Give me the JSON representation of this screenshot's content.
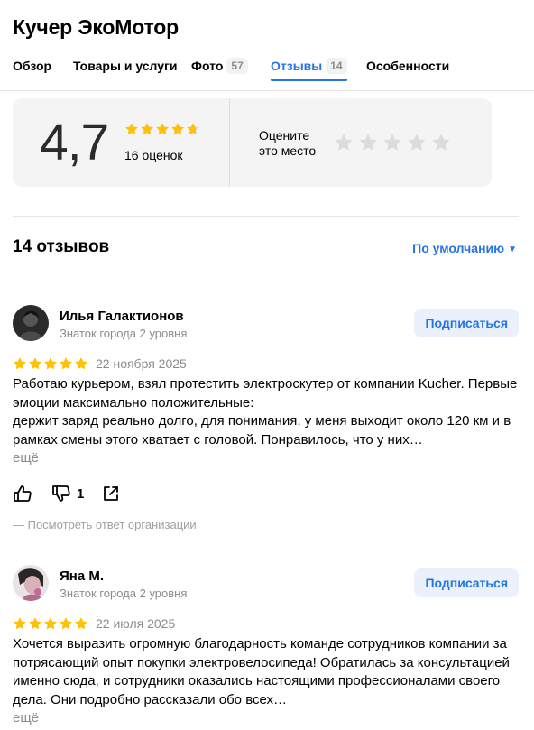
{
  "header": {
    "title": "Кучер ЭкоМотор"
  },
  "tabs": [
    {
      "label": "Обзор",
      "count": null
    },
    {
      "label": "Товары и услуги",
      "count": null
    },
    {
      "label": "Фото",
      "count": "57"
    },
    {
      "label": "Отзывы",
      "count": "14"
    },
    {
      "label": "Особенности",
      "count": null
    }
  ],
  "active_tab": "Отзывы",
  "rating": {
    "value": "4,7",
    "stars": 4.7,
    "count_label": "16 оценок",
    "rate_prompt_line1": "Оцените",
    "rate_prompt_line2": "это место",
    "rate_star_count": 5
  },
  "reviews_section": {
    "title": "14 отзывов",
    "sort_label": "По умолчанию"
  },
  "colors": {
    "accent": "#2673e3",
    "star": "#ffc107",
    "star_empty": "#dcdcdc",
    "muted": "#8c8c8c"
  },
  "reviews": [
    {
      "author": "Илья Галактионов",
      "level": "Знаток города 2 уровня",
      "subscribe_label": "Подписаться",
      "stars": 5,
      "date": "22 ноября 2025",
      "text": "Работаю курьером, взял протестить электроскутер от компании Kucher. Первые эмоции максимально положительные:\nдержит заряд реально долго, для понимания, у меня выходит около 120 км и в рамках смены этого хватает с головой. Понравилось, что у них…",
      "more_label": "ещё",
      "dislikes": "1",
      "org_answer_label": "— Посмотреть ответ организации"
    },
    {
      "author": "Яна М.",
      "level": "Знаток города 2 уровня",
      "subscribe_label": "Подписаться",
      "stars": 5,
      "date": "22 июля 2025",
      "text": "Хочется выразить огромную благодарность команде сотрудников компании за потрясающий опыт покупки электровелосипеда! Обратилась за консультацией именно сюда, и сотрудники оказались настоящими профессионалами своего дела. Они подробно рассказали обо всех…",
      "more_label": "ещё"
    }
  ]
}
